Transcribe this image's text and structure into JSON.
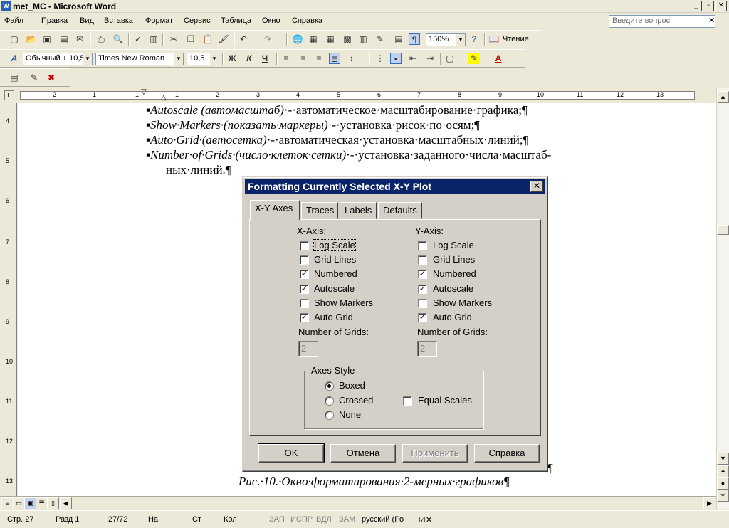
{
  "window": {
    "title": "met_MC - Microsoft Word",
    "app_icon": "word-icon"
  },
  "menu": {
    "items": [
      "Файл",
      "Правка",
      "Вид",
      "Вставка",
      "Формат",
      "Сервис",
      "Таблица",
      "Окно",
      "Справка"
    ],
    "ask_placeholder": "Введите вопрос"
  },
  "toolbar": {
    "zoom": "150%",
    "read_label": "Чтение",
    "style": "Обычный + 10,5",
    "font": "Times New Roman",
    "size": "10,5",
    "bold": "Ж",
    "italic": "К",
    "underline": "Ч"
  },
  "ruler": {
    "numbers": [
      "2",
      "1",
      "1",
      "1",
      "2",
      "3",
      "4",
      "5",
      "6",
      "7",
      "8",
      "9",
      "10",
      "11",
      "12",
      "13"
    ]
  },
  "vruler": {
    "numbers": [
      "4",
      "5",
      "6",
      "7",
      "8",
      "9",
      "10",
      "11",
      "12",
      "13"
    ]
  },
  "document": {
    "lines": [
      {
        "italic": "Autoscale (автомасштаб)",
        "rest": "·-·автоматическое·масштабирование·графика;¶"
      },
      {
        "italic": "Show·Markers·(показать·маркеры)",
        "rest": "·-·установка·рисок·по·осям;¶"
      },
      {
        "italic": "Auto·Grid·(автосетка)",
        "rest": "·-·автоматическая·установка·масштабных·линий;¶"
      },
      {
        "italic": "Number·of·Grids·(число·клеток·сетки)",
        "rest": "·-·установка·заданного·числа·масштаб-"
      },
      {
        "italic": "",
        "rest": "ных·линий.¶"
      }
    ],
    "pilcrow": "¶",
    "caption": "Рис.·10.·Окно·форматирования·2-мерных·графиков¶"
  },
  "dialog": {
    "title": "Formatting Currently Selected X-Y Plot",
    "tabs": [
      "X-Y Axes",
      "Traces",
      "Labels",
      "Defaults"
    ],
    "active_tab": 0,
    "x_axis": {
      "heading": "X-Axis:",
      "options": [
        {
          "label": "Log Scale",
          "checked": false
        },
        {
          "label": "Grid Lines",
          "checked": false
        },
        {
          "label": "Numbered",
          "checked": true
        },
        {
          "label": "Autoscale",
          "checked": true
        },
        {
          "label": "Show Markers",
          "checked": false
        },
        {
          "label": "Auto Grid",
          "checked": true
        }
      ],
      "grids_label": "Number of Grids:",
      "grids_value": "2"
    },
    "y_axis": {
      "heading": "Y-Axis:",
      "options": [
        {
          "label": "Log Scale",
          "checked": false
        },
        {
          "label": "Grid Lines",
          "checked": false
        },
        {
          "label": "Numbered",
          "checked": true
        },
        {
          "label": "Autoscale",
          "checked": true
        },
        {
          "label": "Show Markers",
          "checked": false
        },
        {
          "label": "Auto Grid",
          "checked": true
        }
      ],
      "grids_label": "Number of Grids:",
      "grids_value": "2"
    },
    "axes_style": {
      "title": "Axes Style",
      "options": [
        {
          "label": "Boxed",
          "selected": true
        },
        {
          "label": "Crossed",
          "selected": false
        },
        {
          "label": "None",
          "selected": false
        }
      ],
      "equal_scales": {
        "label": "Equal Scales",
        "checked": false
      }
    },
    "buttons": {
      "ok": "OK",
      "cancel": "Отмена",
      "apply": "Применить",
      "help": "Справка"
    }
  },
  "status": {
    "page": "Стр. 27",
    "section": "Разд 1",
    "pages": "27/72",
    "at": "На",
    "line": "Ст",
    "col": "Кол",
    "rec": "ЗАП",
    "trk": "ИСПР",
    "ext": "ВДЛ",
    "ovr": "ЗАМ",
    "lang": "русский (Ро"
  }
}
